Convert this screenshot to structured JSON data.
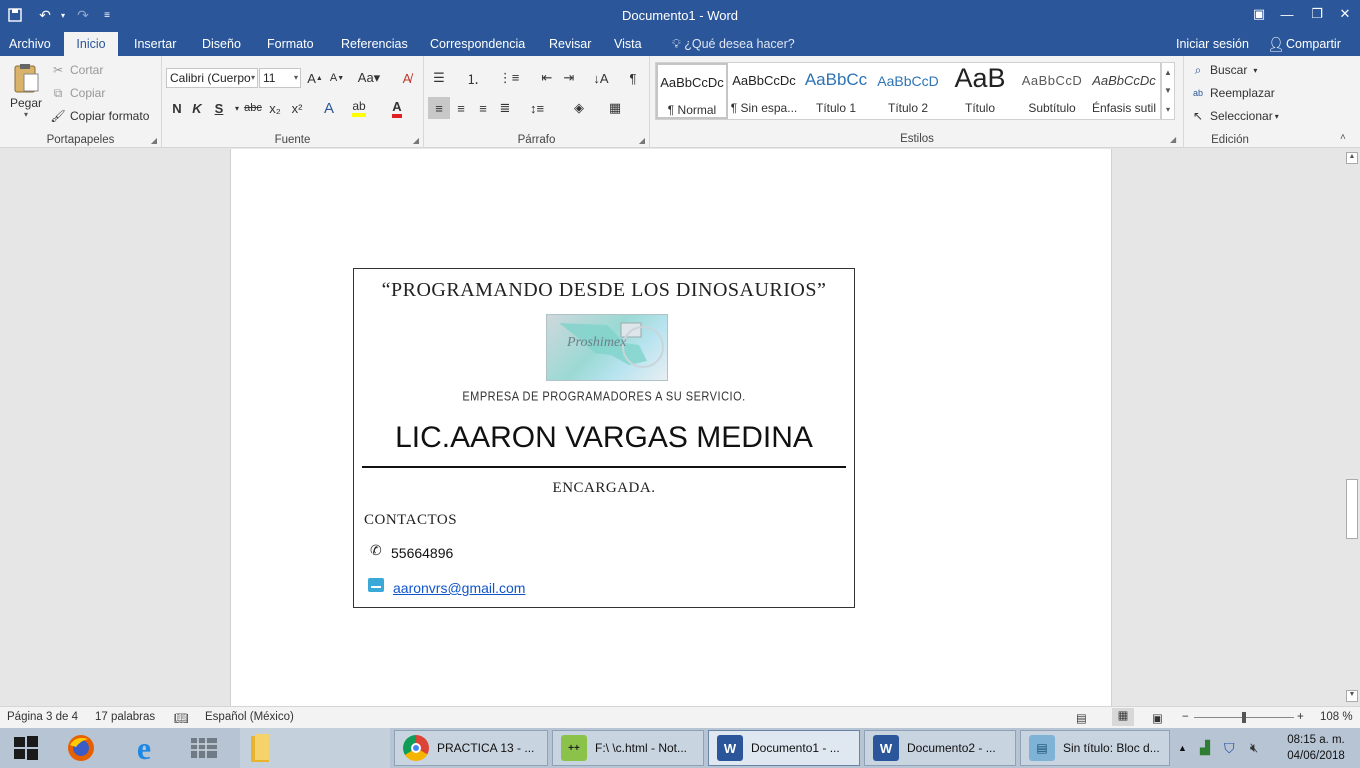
{
  "window": {
    "title": "Documento1 - Word",
    "qat": {
      "save_icon": "save-icon",
      "undo_icon": "undo-icon",
      "redo_icon": "redo-icon",
      "customize_icon": "customize-icon"
    }
  },
  "tabs": [
    {
      "label": "Archivo"
    },
    {
      "label": "Inicio",
      "active": true
    },
    {
      "label": "Insertar"
    },
    {
      "label": "Diseño"
    },
    {
      "label": "Formato"
    },
    {
      "label": "Referencias"
    },
    {
      "label": "Correspondencia"
    },
    {
      "label": "Revisar"
    },
    {
      "label": "Vista"
    }
  ],
  "tell_me": "¿Qué desea hacer?",
  "signin": "Iniciar sesión",
  "share": "Compartir",
  "ribbon": {
    "clipboard": {
      "label": "Portapapeles",
      "paste": "Pegar",
      "cut": "Cortar",
      "copy": "Copiar",
      "format_painter": "Copiar formato"
    },
    "font": {
      "label": "Fuente",
      "font_name": "Calibri (Cuerpo",
      "font_size": "11",
      "bold": "N",
      "italic": "K",
      "underline": "S",
      "strike": "abc",
      "subscript": "x₂",
      "superscript": "x²"
    },
    "paragraph": {
      "label": "Párrafo"
    },
    "styles": {
      "label": "Estilos",
      "items": [
        {
          "preview": "AaBbCcDc",
          "name": "¶ Normal"
        },
        {
          "preview": "AaBbCcDc",
          "name": "¶ Sin espa..."
        },
        {
          "preview": "AaBbCc",
          "name": "Título 1"
        },
        {
          "preview": "AaBbCcD",
          "name": "Título 2"
        },
        {
          "preview": "AaB",
          "name": "Título"
        },
        {
          "preview": "AaBbCcD",
          "name": "Subtítulo"
        },
        {
          "preview": "AaBbCcDc",
          "name": "Énfasis sutil"
        }
      ]
    },
    "editing": {
      "label": "Edición",
      "find": "Buscar",
      "replace": "Reemplazar",
      "select": "Seleccionar"
    }
  },
  "document": {
    "slogan": "“PROGRAMANDO DESDE LOS DINOSAURIOS”",
    "logo_text": "Proshimex",
    "tagline": "EMPRESA DE PROGRAMADORES A SU SERVICIO.",
    "person": "LIC.AARON VARGAS MEDINA",
    "role": "ENCARGADA.",
    "contacts_heading": "CONTACTOS",
    "phone": "55664896",
    "email": "aaronvrs@gmail.com"
  },
  "status": {
    "page": "Página 3 de 4",
    "words": "17 palabras",
    "language": "Español (México)",
    "zoom": "108 %",
    "zoom_value": 108
  },
  "taskbar": {
    "windows": [
      {
        "label": "PRACTICA 13 - ...",
        "icon": "chrome-icon"
      },
      {
        "label": "F:\\ \\c.html - Not...",
        "icon": "notepadpp-icon"
      },
      {
        "label": "Documento1 - ...",
        "icon": "word-icon",
        "active": true
      },
      {
        "label": "Documento2 - ...",
        "icon": "word-icon"
      },
      {
        "label": "Sin título: Bloc d...",
        "icon": "notepad-icon"
      }
    ],
    "time": "08:15 a. m.",
    "date": "04/06/2018"
  },
  "colors": {
    "word_blue": "#2b579a",
    "link_blue": "#1155cc",
    "taskbar": "#b7c4d4"
  }
}
